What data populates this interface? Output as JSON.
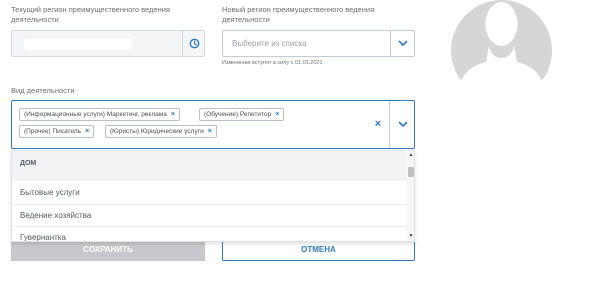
{
  "form": {
    "current_region_label": "Текущий регион преимущественного ведения деятельности",
    "new_region_label": "Новый регион преимущественного ведения деятельности",
    "new_region_placeholder": "Выберите из списка",
    "effective_note": "Изменения вступят в силу с 01.01.2021",
    "activity_label": "Вид деятельности",
    "selected_activities": [
      "(Информационные услуги) Маркетинг, реклама",
      "(Обучение) Репетитор",
      "(Прочее) Писатель",
      "(Юристы) Юридические услуги"
    ],
    "chip_remove_symbol": "×",
    "clear_symbol": "×"
  },
  "dropdown": {
    "group_header": "ДОМ",
    "items": [
      "Бытовые услуги",
      "Ведение хозяйства",
      "Гувернантка"
    ],
    "scroll_up_symbol": "▲",
    "scroll_down_symbol": "▼"
  },
  "buttons": {
    "save_label": "СОХРАНИТЬ",
    "cancel_label": "ОТМЕНА"
  },
  "icons": {
    "history": "history-icon",
    "chevron": "chevron-down-icon",
    "avatar": "avatar-placeholder-icon"
  },
  "colors": {
    "accent": "#2f79c2",
    "disabled_button": "#c6c8cb",
    "avatar_bg": "#d6d6d6",
    "avatar_fg": "#ffffff"
  }
}
